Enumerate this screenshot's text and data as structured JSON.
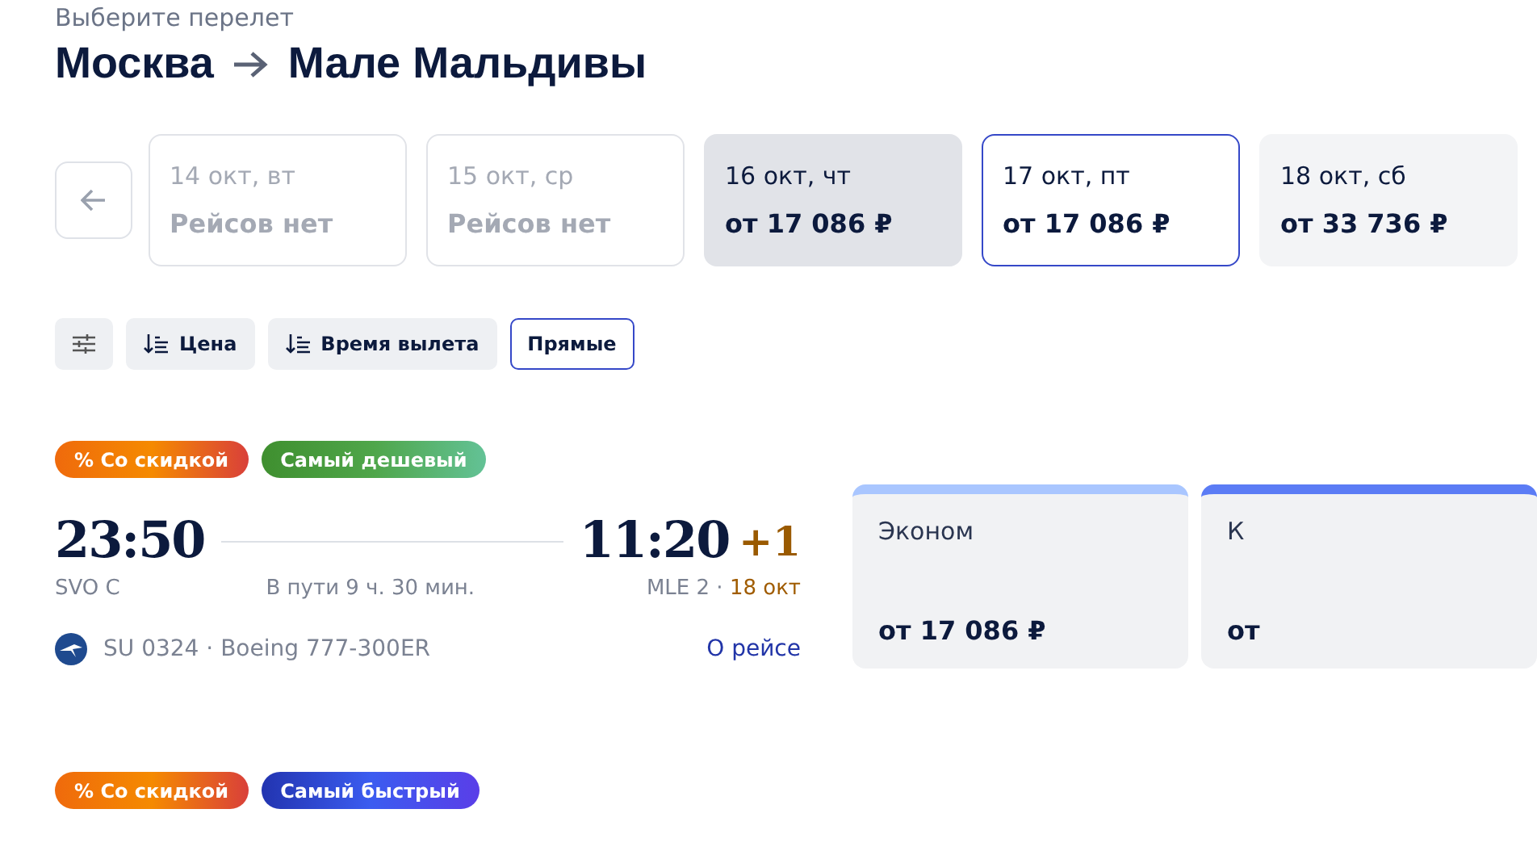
{
  "header": {
    "subtitle": "Выберите перелет",
    "origin": "Москва",
    "destination": "Мале Мальдивы"
  },
  "dates": [
    {
      "date": "14 окт, вт",
      "price": "Рейсов нет",
      "disabled": true,
      "selected": false,
      "hovered": false
    },
    {
      "date": "15 окт, ср",
      "price": "Рейсов нет",
      "disabled": true,
      "selected": false,
      "hovered": false
    },
    {
      "date": "16 окт, чт",
      "price": "от 17 086 ₽",
      "disabled": false,
      "selected": false,
      "hovered": true
    },
    {
      "date": "17 окт, пт",
      "price": "от 17 086 ₽",
      "disabled": false,
      "selected": true,
      "hovered": false
    },
    {
      "date": "18 окт, сб",
      "price": "от 33 736 ₽",
      "disabled": false,
      "selected": false,
      "hovered": false
    }
  ],
  "filters": [
    {
      "kind": "settings",
      "selected": false
    },
    {
      "kind": "sort",
      "label": "Цена",
      "selected": false
    },
    {
      "kind": "sort",
      "label": "Время вылета",
      "selected": false
    },
    {
      "kind": "toggle",
      "label": "Прямые",
      "selected": true
    }
  ],
  "flights": [
    {
      "tags": [
        {
          "kind": "discount",
          "label": "% Со скидкой"
        },
        {
          "kind": "cheapest",
          "label": "Самый дешевый"
        }
      ],
      "departure_time": "23:50",
      "departure_airport": "SVO C",
      "duration": "В пути 9 ч. 30 мин.",
      "arrival_time": "11:20",
      "day_shift": "+1",
      "arrival_airport": "MLE 2 ·",
      "arrival_date": "18 окт",
      "flight_info": "SU 0324 · Boeing 777-300ER",
      "details_link": "О рейсе",
      "fares": [
        {
          "name": "Эконом",
          "price": "от 17 086 ₽",
          "color": "#a9c6ff"
        },
        {
          "name": "К",
          "price": "от",
          "color": "#5b7cf5"
        }
      ]
    },
    {
      "tags": [
        {
          "kind": "discount",
          "label": "% Со скидкой"
        },
        {
          "kind": "fastest",
          "label": "Самый быстрый"
        }
      ]
    }
  ]
}
